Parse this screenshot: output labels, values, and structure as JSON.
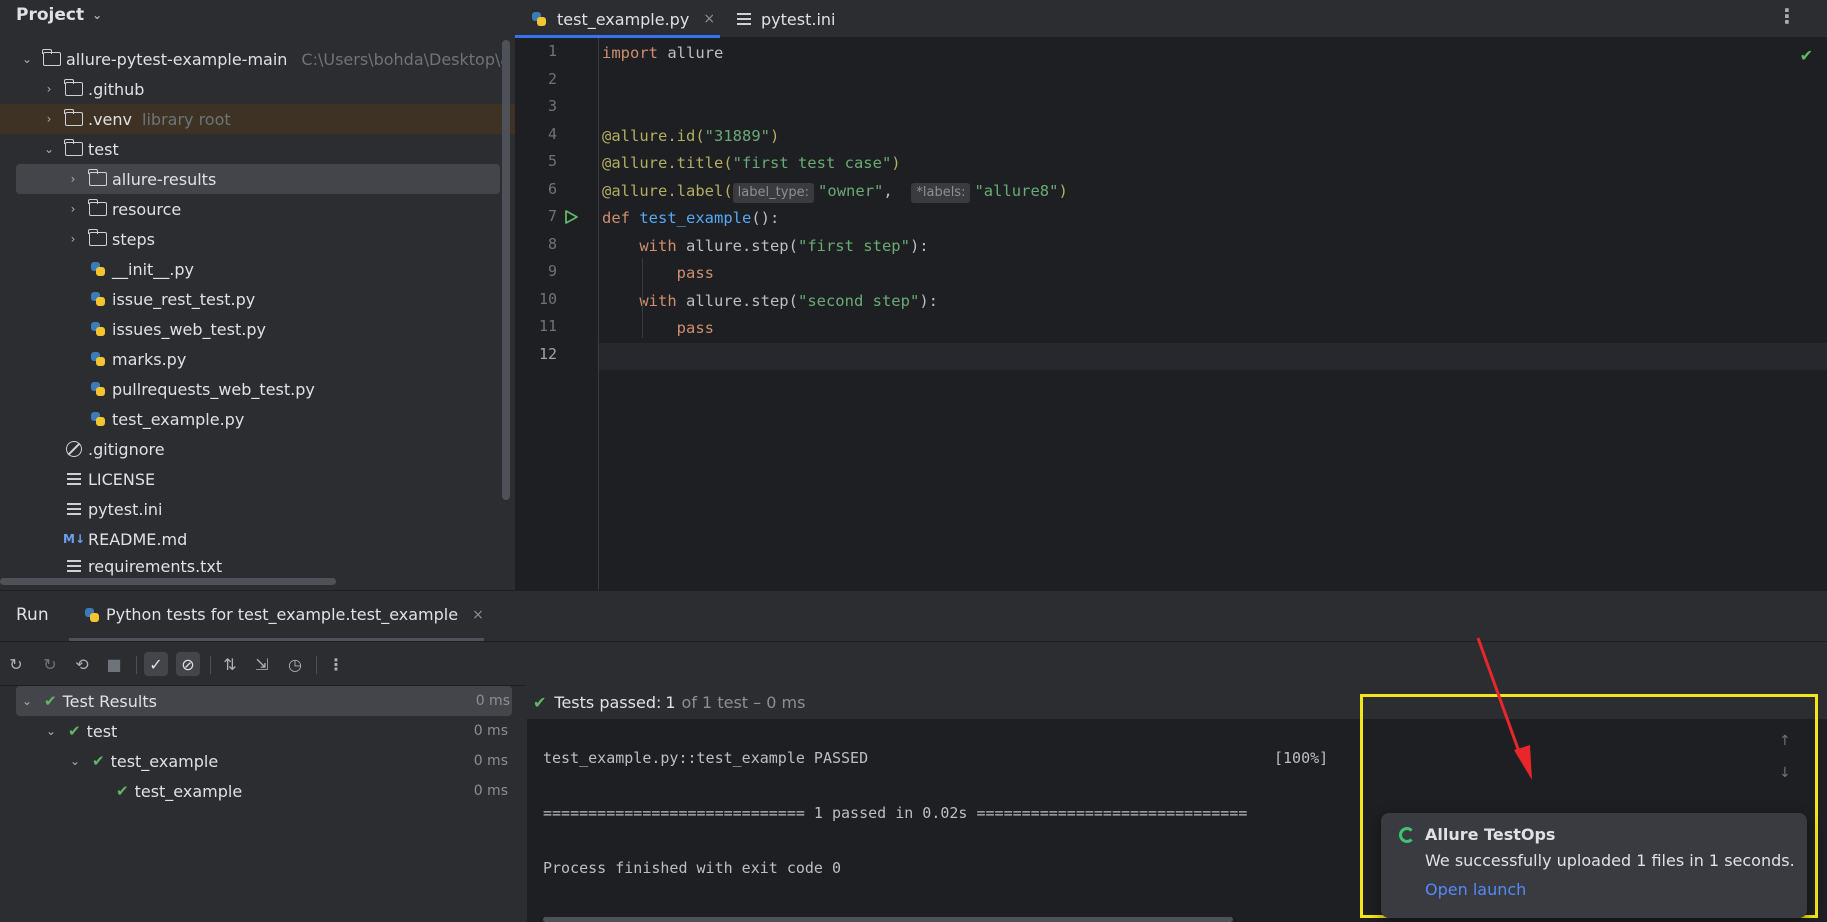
{
  "project": {
    "title": "Project",
    "root": {
      "name": "allure-pytest-example-main",
      "path": "C:\\Users\\bohda\\Desktop\\a"
    },
    "items": [
      {
        "label": ".github",
        "hint": ""
      },
      {
        "label": ".venv",
        "hint": "library root"
      },
      {
        "label": "test",
        "hint": ""
      },
      {
        "label": "allure-results",
        "hint": ""
      },
      {
        "label": "resource",
        "hint": ""
      },
      {
        "label": "steps",
        "hint": ""
      },
      {
        "label": "__init__.py",
        "hint": ""
      },
      {
        "label": "issue_rest_test.py",
        "hint": ""
      },
      {
        "label": "issues_web_test.py",
        "hint": ""
      },
      {
        "label": "marks.py",
        "hint": ""
      },
      {
        "label": "pullrequests_web_test.py",
        "hint": ""
      },
      {
        "label": "test_example.py",
        "hint": ""
      },
      {
        "label": ".gitignore",
        "hint": ""
      },
      {
        "label": "LICENSE",
        "hint": ""
      },
      {
        "label": "pytest.ini",
        "hint": ""
      },
      {
        "label": "README.md",
        "hint": ""
      },
      {
        "label": "requirements.txt",
        "hint": ""
      }
    ]
  },
  "editor": {
    "tabs": [
      {
        "label": "test_example.py",
        "close": "×"
      },
      {
        "label": "pytest.ini"
      }
    ],
    "line_numbers": [
      "1",
      "2",
      "3",
      "4",
      "5",
      "6",
      "7",
      "8",
      "9",
      "10",
      "11",
      "12"
    ],
    "code": {
      "l1_kw": "import",
      "l1_rest": " allure",
      "l4_dec": "@allure.id(",
      "l4_str": "\"31889\"",
      "l4_end": ")",
      "l5_dec": "@allure.title(",
      "l5_str": "\"first test case\"",
      "l5_end": ")",
      "l6_dec": "@allure.label(",
      "l6_hint1": "label_type:",
      "l6_str1": "\"owner\"",
      "l6_comma": ",  ",
      "l6_hint2": "*labels:",
      "l6_str2": "\"allure8\"",
      "l6_end": ")",
      "l7_kw": "def",
      "l7_fn": "test_example",
      "l7_end": "():",
      "l8_kw": "with",
      "l8_mid": " allure.step(",
      "l8_str": "\"first step\"",
      "l8_end": "):",
      "l9_kw": "pass",
      "l10_kw": "with",
      "l10_mid": " allure.step(",
      "l10_str": "\"second step\"",
      "l10_end": "):",
      "l11_kw": "pass"
    }
  },
  "run": {
    "title": "Run",
    "tab": "Python tests for test_example.test_example",
    "tab_close": "×",
    "results": [
      {
        "label": "Test Results",
        "time": "0 ms"
      },
      {
        "label": "test",
        "time": "0 ms"
      },
      {
        "label": "test_example",
        "time": "0 ms"
      },
      {
        "label": "test_example",
        "time": "0 ms"
      }
    ],
    "status": {
      "prefix": "Tests passed: ",
      "count": "1",
      "suffix": "of 1 test – 0 ms"
    },
    "console": {
      "line1": "test_example.py::test_example PASSED",
      "percent": "[100%]",
      "line2": "============================= 1 passed in 0.02s ==============================",
      "line3": "Process finished with exit code 0"
    }
  },
  "notification": {
    "title": "Allure TestOps",
    "message": "We successfully uploaded 1 files in 1 seconds.",
    "link": "Open launch"
  },
  "colors": {
    "highlight": "#f5e51b",
    "arrow": "#e8262b",
    "success": "#5fb865",
    "link": "#548af7"
  }
}
